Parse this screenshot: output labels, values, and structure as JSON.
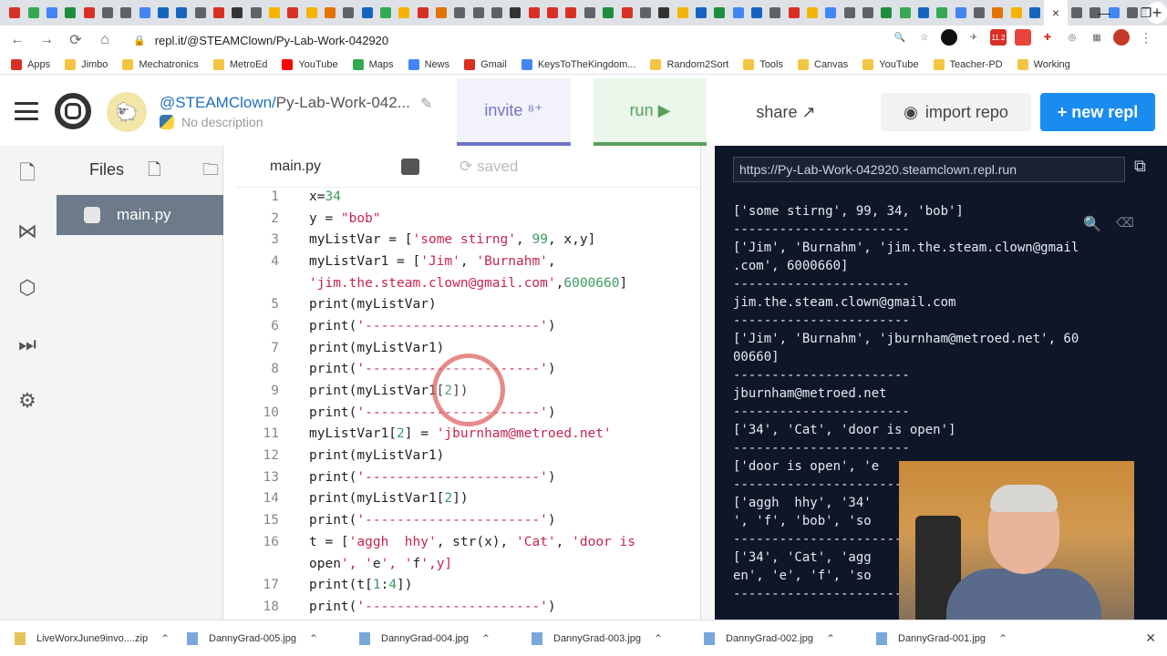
{
  "browser": {
    "url": "repl.it/@STEAMClown/Py-Lab-Work-042920",
    "active_tab_close": "×",
    "new_tab": "+",
    "window_min": "—",
    "window_max": "❐",
    "window_close": "✕",
    "ext_badge": "11.2"
  },
  "bookmarks": [
    {
      "label": "Apps",
      "color": "#d93025"
    },
    {
      "label": "Jimbo",
      "color": "#f4c542"
    },
    {
      "label": "Mechatronics",
      "color": "#f4c542"
    },
    {
      "label": "MetroEd",
      "color": "#f4c542"
    },
    {
      "label": "YouTube",
      "color": "#ff0000"
    },
    {
      "label": "Maps",
      "color": "#34a853"
    },
    {
      "label": "News",
      "color": "#4285f4"
    },
    {
      "label": "Gmail",
      "color": "#d93025"
    },
    {
      "label": "KeysToTheKingdom...",
      "color": "#4285f4"
    },
    {
      "label": "Random2Sort",
      "color": "#f4c542"
    },
    {
      "label": "Tools",
      "color": "#f4c542"
    },
    {
      "label": "Canvas",
      "color": "#f4c542"
    },
    {
      "label": "YouTube",
      "color": "#f4c542"
    },
    {
      "label": "Teacher-PD",
      "color": "#f4c542"
    },
    {
      "label": "Working",
      "color": "#f4c542"
    }
  ],
  "repl": {
    "owner": "@STEAMClown/",
    "name": "Py-Lab-Work-042...",
    "description": "No description",
    "invite_label": "invite",
    "invite_icon": "⁸⁺",
    "run_label": "run",
    "run_icon": "▶",
    "share_label": "share",
    "share_icon": "↗",
    "import_label": "import repo",
    "new_repl_label": "+ new repl"
  },
  "files": {
    "header": "Files",
    "items": [
      "main.py"
    ]
  },
  "editor": {
    "tab": "main.py",
    "status": "saved",
    "lines": [
      {
        "n": "1",
        "code": "x=34"
      },
      {
        "n": "2",
        "code": "y = \"bob\""
      },
      {
        "n": "3",
        "code": "myListVar = ['some stirng', 99, x,y]"
      },
      {
        "n": "4",
        "code": "myListVar1 = ['Jim', 'Burnahm',"
      },
      {
        "n": "",
        "code": "'jim.the.steam.clown@gmail.com',6000660]"
      },
      {
        "n": "5",
        "code": "print(myListVar)"
      },
      {
        "n": "6",
        "code": "print('----------------------')"
      },
      {
        "n": "7",
        "code": "print(myListVar1)"
      },
      {
        "n": "8",
        "code": "print('----------------------')"
      },
      {
        "n": "9",
        "code": "print(myListVar1[2])"
      },
      {
        "n": "10",
        "code": "print('----------------------')"
      },
      {
        "n": "11",
        "code": "myListVar1[2] = 'jburnham@metroed.net'"
      },
      {
        "n": "12",
        "code": "print(myListVar1)"
      },
      {
        "n": "13",
        "code": "print('----------------------')"
      },
      {
        "n": "14",
        "code": "print(myListVar1[2])"
      },
      {
        "n": "15",
        "code": "print('----------------------')"
      },
      {
        "n": "16",
        "code": "t = ['aggh  hhy', str(x), 'Cat', 'door is"
      },
      {
        "n": "",
        "code": "open', 'e', 'f',y]"
      },
      {
        "n": "17",
        "code": "print(t[1:4])"
      },
      {
        "n": "18",
        "code": "print('----------------------')"
      }
    ]
  },
  "console": {
    "url": "https://Py-Lab-Work-042920.steamclown.repl.run",
    "output": "['some stirng', 99, 34, 'bob']\n-----------------------\n['Jim', 'Burnahm', 'jim.the.steam.clown@gmail\n.com', 6000660]\n-----------------------\njim.the.steam.clown@gmail.com\n-----------------------\n['Jim', 'Burnahm', 'jburnham@metroed.net', 60\n00660]\n-----------------------\njburnham@metroed.net\n-----------------------\n['34', 'Cat', 'door is open']\n-----------------------\n['door is open', 'e\n-----------------------\n['aggh  hhy', '34'                          e\n', 'f', 'bob', 'so\n-----------------------\n['34', 'Cat', 'agg                          p\nen', 'e', 'f', 'so\n-----------------------"
  },
  "downloads": [
    {
      "name": "LiveWorxJune9invo....zip",
      "zip": true
    },
    {
      "name": "DannyGrad-005.jpg",
      "zip": false
    },
    {
      "name": "DannyGrad-004.jpg",
      "zip": false
    },
    {
      "name": "DannyGrad-003.jpg",
      "zip": false
    },
    {
      "name": "DannyGrad-002.jpg",
      "zip": false
    },
    {
      "name": "DannyGrad-001.jpg",
      "zip": false
    }
  ],
  "downloads_close": "✕"
}
